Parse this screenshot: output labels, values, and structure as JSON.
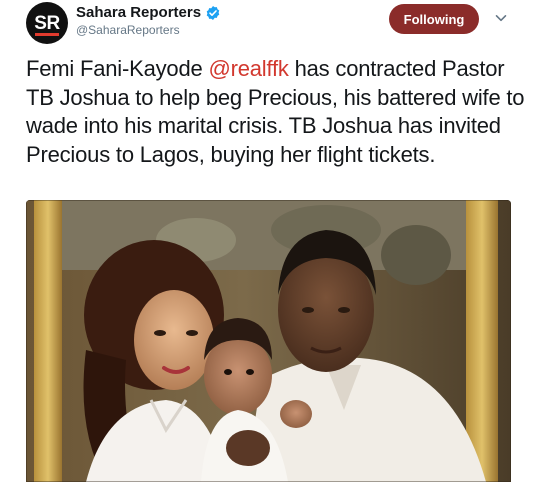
{
  "account": {
    "avatar_text": "SR",
    "display_name": "Sahara Reporters",
    "handle": "@SaharaReporters",
    "verified": true
  },
  "follow_button": {
    "label": "Following"
  },
  "tweet": {
    "text_before": "Femi Fani-Kayode ",
    "mention": "@realffk",
    "text_after": " has contracted Pastor TB Joshua to help beg Precious, his battered wife to wade into his marital crisis. TB Joshua has invited Precious to Lagos, buying her flight tickets."
  },
  "colors": {
    "follow_button_bg": "#8b2c2a",
    "mention": "#d2382e",
    "verified": "#1da1f2",
    "text": "#14171a",
    "muted": "#657786"
  },
  "icons": {
    "verified": "verified-badge-icon",
    "menu": "chevron-down-icon"
  }
}
